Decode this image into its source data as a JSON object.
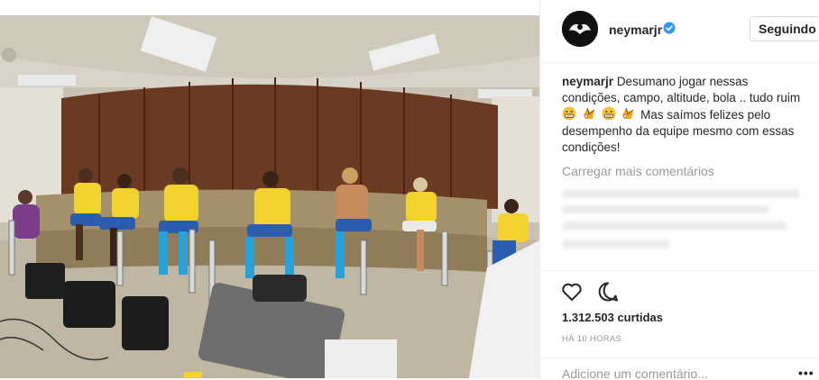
{
  "post": {
    "photo_alt": "",
    "user": {
      "username": "neymarjr",
      "verified": true,
      "follow_label": "Seguindo"
    },
    "caption": {
      "user": "neymarjr",
      "text_part1": "Desumano jogar nessas condições, campo, altitude, bola .. tudo ruim",
      "emojis": [
        "grimacing-face",
        "broken-ball",
        "grimacing-face",
        "broken-ball"
      ],
      "text_part2": "Mas saímos felizes pelo desempenho da equipe mesmo com essas condições!"
    },
    "load_more_label": "Carregar mais comentários",
    "likes": "1.312.503 curtidas",
    "time_ago": "HÁ 10 HORAS",
    "comment_input_placeholder": "Adicione um comentário...",
    "more_options_label": "•••",
    "icons": {
      "like": "heart-icon",
      "comment": "comment-bubble-icon",
      "verified": "verified-badge-icon",
      "more": "more-options-icon"
    },
    "colors": {
      "verified_blue": "#3897f0",
      "muted_text": "#999999",
      "jersey_yellow": "#f2d22e",
      "shorts_blue": "#2a5db0"
    }
  }
}
